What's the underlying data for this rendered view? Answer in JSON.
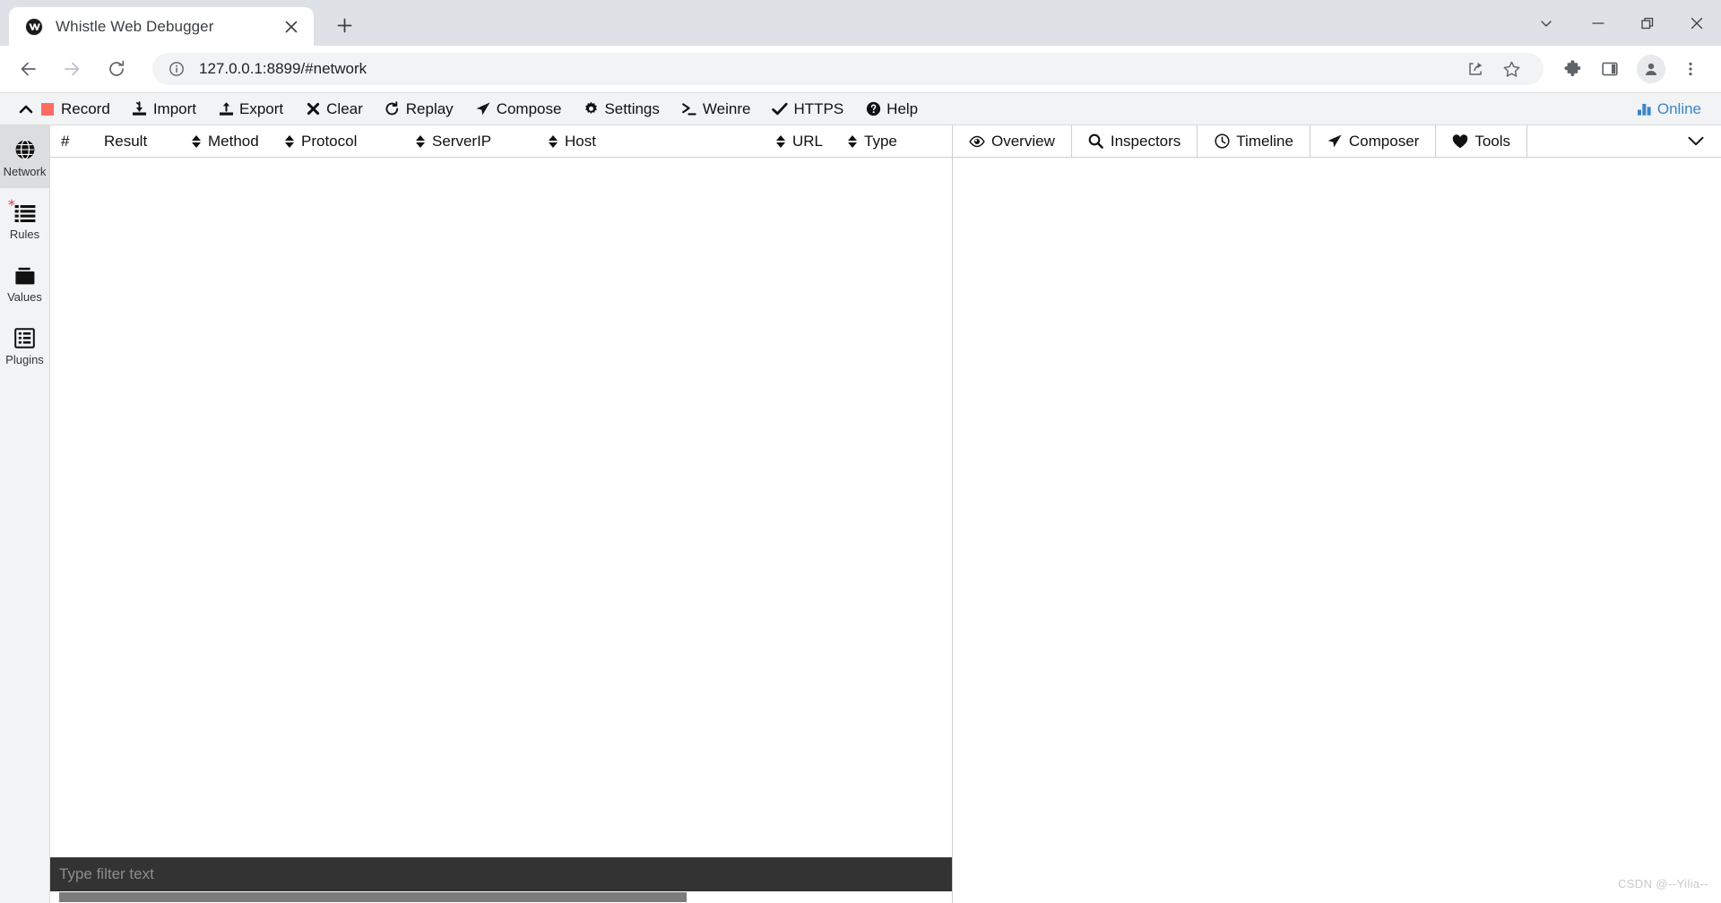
{
  "browser": {
    "tab": {
      "title": "Whistle Web Debugger",
      "favicon": "whistle-logo-icon",
      "close": "close-icon"
    },
    "newtab_label": "+",
    "window_controls": [
      {
        "name": "tab-search",
        "glyph": "chevron-down-icon"
      },
      {
        "name": "minimize",
        "glyph": "minimize-icon"
      },
      {
        "name": "restore",
        "glyph": "restore-icon"
      },
      {
        "name": "close",
        "glyph": "close-icon"
      }
    ],
    "nav": {
      "back": "back-arrow-icon",
      "forward": "forward-arrow-icon",
      "reload": "reload-icon",
      "info": "site-info-icon",
      "url": "127.0.0.1:8899/#network",
      "share": "share-icon",
      "bookmark": "star-icon",
      "extensions": "puzzle-icon",
      "side_panel": "side-panel-icon",
      "profile": "profile-avatar-icon",
      "menu": "kebab-menu-icon"
    }
  },
  "app": {
    "toolbar": {
      "collapse": "chevron-up-icon",
      "items": [
        {
          "label": "Record",
          "icon": "record-square-icon"
        },
        {
          "label": "Import",
          "icon": "import-icon"
        },
        {
          "label": "Export",
          "icon": "export-icon"
        },
        {
          "label": "Clear",
          "icon": "cross-icon"
        },
        {
          "label": "Replay",
          "icon": "refresh-icon"
        },
        {
          "label": "Compose",
          "icon": "paper-plane-icon"
        },
        {
          "label": "Settings",
          "icon": "gear-icon"
        },
        {
          "label": "Weinre",
          "icon": "terminal-icon"
        },
        {
          "label": "HTTPS",
          "icon": "check-icon"
        },
        {
          "label": "Help",
          "icon": "question-circle-icon"
        }
      ],
      "status": {
        "label": "Online",
        "icon": "bar-chart-icon",
        "color": "#3a86c8"
      }
    },
    "sidebar": {
      "items": [
        {
          "label": "Network",
          "icon": "globe-icon",
          "active": true,
          "badge": ""
        },
        {
          "label": "Rules",
          "icon": "list-icon",
          "active": false,
          "badge": "*"
        },
        {
          "label": "Values",
          "icon": "folder-icon",
          "active": false,
          "badge": ""
        },
        {
          "label": "Plugins",
          "icon": "plugins-icon",
          "active": false,
          "badge": ""
        }
      ]
    },
    "network_table": {
      "columns": [
        {
          "label": "#",
          "sortable": false
        },
        {
          "label": "Result",
          "sortable": true
        },
        {
          "label": "Method",
          "sortable": true
        },
        {
          "label": "Protocol",
          "sortable": true
        },
        {
          "label": "ServerIP",
          "sortable": true
        },
        {
          "label": "Host",
          "sortable": true
        },
        {
          "label": "URL",
          "sortable": true
        },
        {
          "label": "Type",
          "sortable": false
        }
      ],
      "rows": []
    },
    "filter": {
      "placeholder": "Type filter text",
      "value": ""
    },
    "detail_tabs": [
      {
        "label": "Overview",
        "icon": "eye-icon"
      },
      {
        "label": "Inspectors",
        "icon": "search-icon"
      },
      {
        "label": "Timeline",
        "icon": "clock-icon"
      },
      {
        "label": "Composer",
        "icon": "paper-plane-icon"
      },
      {
        "label": "Tools",
        "icon": "heart-icon"
      }
    ],
    "detail_tabs_more": "chevron-down-icon"
  },
  "watermark": "CSDN @--Yilia--"
}
